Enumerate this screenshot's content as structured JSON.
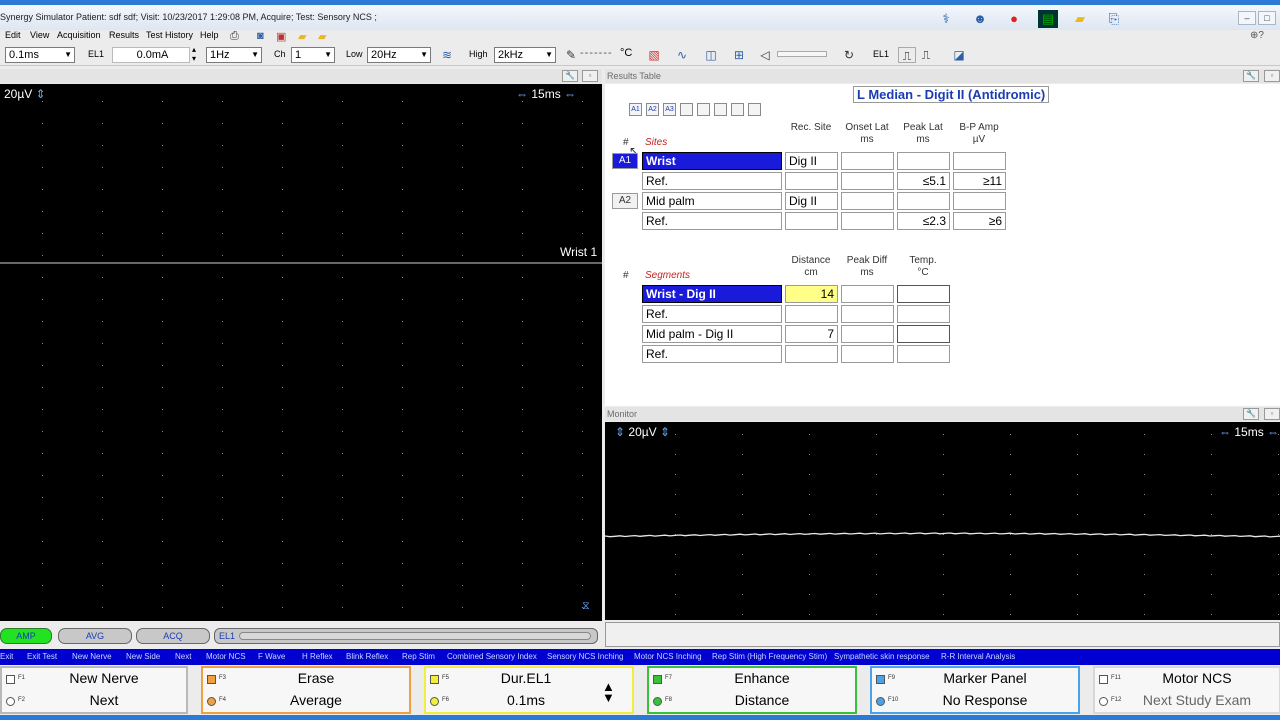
{
  "window": {
    "title": "Synergy Simulator     Patient: sdf sdf;    Visit: 10/23/2017 1:29:08 PM, Acquire; Test: Sensory NCS ;",
    "minimize": "–",
    "maximize": "□",
    "close": "✕"
  },
  "menu": [
    "Edit",
    "View",
    "Acquisition",
    "Results",
    "Test History",
    "Help"
  ],
  "toolbar": {
    "timebase": "0.1ms",
    "el1_label": "EL1",
    "current": "0.0mA",
    "rate": "1Hz",
    "ch_label": "Ch",
    "channel": "1",
    "low_label": "Low",
    "low_value": "20Hz",
    "high_label": "High",
    "high_value": "2kHz",
    "temp_unit": "°C",
    "el1_right": "EL1"
  },
  "results": {
    "header": "Results Table",
    "title": "L Median - Digit II (Antidromic)",
    "marker_tags": [
      "A1",
      "A2",
      "A3",
      "",
      "",
      "",
      "",
      ""
    ],
    "site_columns": [
      {
        "line1": "Rec. Site",
        "line2": ""
      },
      {
        "line1": "Onset Lat",
        "line2": "ms"
      },
      {
        "line1": "Peak Lat",
        "line2": "ms"
      },
      {
        "line1": "B-P Amp",
        "line2": "µV"
      }
    ],
    "hash": "#",
    "sites_label": "Sites",
    "sites": [
      {
        "tag": "A1",
        "name": "Wrist",
        "rec": "Dig II",
        "onset": "",
        "peak": "",
        "amp": ""
      },
      {
        "tag": "",
        "name": "Ref.",
        "rec": "",
        "onset": "",
        "peak": "≤5.1",
        "amp": "≥11"
      },
      {
        "tag": "A2",
        "name": "Mid palm",
        "rec": "Dig II",
        "onset": "",
        "peak": "",
        "amp": ""
      },
      {
        "tag": "",
        "name": "Ref.",
        "rec": "",
        "onset": "",
        "peak": "≤2.3",
        "amp": "≥6"
      }
    ],
    "segment_columns": [
      {
        "line1": "Distance",
        "line2": "cm"
      },
      {
        "line1": "Peak Diff",
        "line2": "ms"
      },
      {
        "line1": "Temp.",
        "line2": "°C"
      }
    ],
    "segments_label": "Segments",
    "segments": [
      {
        "name": "Wrist - Dig II",
        "distance": "14",
        "diff": "",
        "temp": ""
      },
      {
        "name": "Ref.",
        "distance": "",
        "diff": "",
        "temp": ""
      },
      {
        "name": "Mid palm - Dig II",
        "distance": "7",
        "diff": "",
        "temp": ""
      },
      {
        "name": "Ref.",
        "distance": "",
        "diff": "",
        "temp": ""
      }
    ]
  },
  "trace": {
    "sensitivity": "20µV",
    "sweep": "15ms",
    "trace_label": "Wrist 1"
  },
  "monitor": {
    "header": "Monitor",
    "sensitivity": "20µV",
    "sweep": "15ms"
  },
  "status_pills": [
    "AMP",
    "AVG",
    "ACQ",
    "EL1"
  ],
  "shortcuts": [
    "Exit",
    "Exit Test",
    "New Nerve",
    "New Side",
    "Next",
    "Motor NCS",
    "F Wave",
    "H Reflex",
    "Blink Reflex",
    "Rep Stim",
    "Combined Sensory Index",
    "Sensory NCS Inching",
    "Motor NCS Inching",
    "Rep Stim (High Frequency Stim)",
    "Sympathetic skin response",
    "R-R Interval Analysis"
  ],
  "fkeys": [
    {
      "color": "#b9b9b9",
      "top": {
        "key": "F1",
        "label": "New Nerve"
      },
      "bottom": {
        "key": "F2",
        "label": "Next"
      }
    },
    {
      "color": "#f0a040",
      "top": {
        "key": "F3",
        "label": "Erase"
      },
      "bottom": {
        "key": "F4",
        "label": "Average"
      }
    },
    {
      "color": "#f2ee3a",
      "top": {
        "key": "F5",
        "label": "Dur.EL1"
      },
      "bottom": {
        "key": "F6",
        "label": "0.1ms"
      }
    },
    {
      "color": "#39c239",
      "top": {
        "key": "F7",
        "label": "Enhance"
      },
      "bottom": {
        "key": "F8",
        "label": "Distance"
      }
    },
    {
      "color": "#4aa3e8",
      "top": {
        "key": "F9",
        "label": "Marker Panel"
      },
      "bottom": {
        "key": "F10",
        "label": "No Response"
      }
    },
    {
      "color": "#d8d8d8",
      "top": {
        "key": "F11",
        "label": "Motor NCS"
      },
      "bottom": {
        "key": "F12",
        "label": "Next Study Exam"
      }
    }
  ]
}
